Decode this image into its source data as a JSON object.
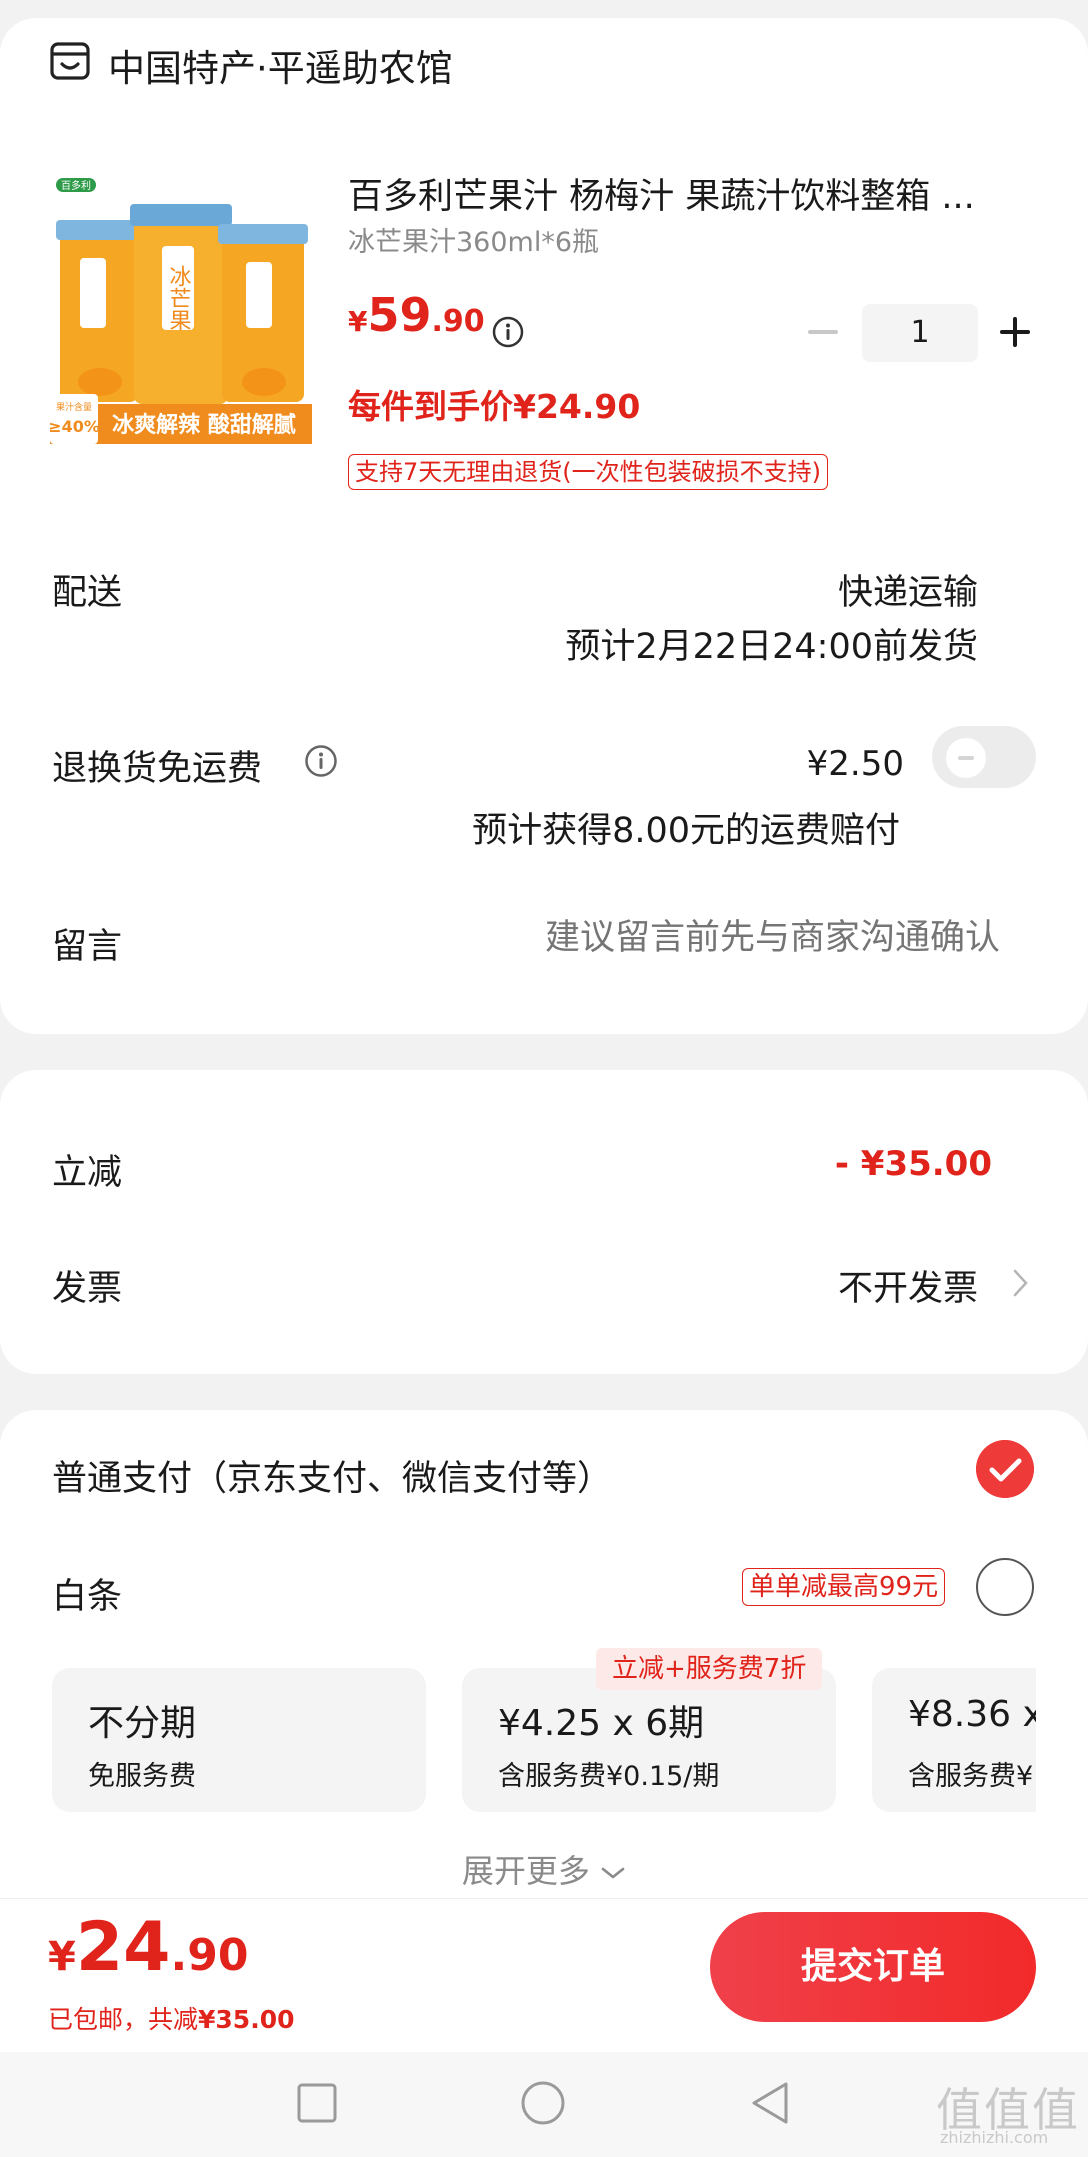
{
  "shop": {
    "name": "中国特产·平遥助农馆",
    "icon": "store-icon"
  },
  "product": {
    "title": "百多利芒果汁 杨梅汁 果蔬汁饮料整箱 ...",
    "spec": "冰芒果汁360ml*6瓶",
    "price_yen": "¥",
    "price_int": "59",
    "price_dec": ".90",
    "final_price": "每件到手价¥24.90",
    "return_policy": "支持7天无理由退货(一次性包装破损不支持)",
    "quantity": "1",
    "image_brand": "百多利",
    "image_text": "冰芒果",
    "image_juice": "果汁含量",
    "image_juice_pct": "≥40%",
    "image_slogan": "冰爽解辣 酸甜解腻"
  },
  "shipping": {
    "label": "配送",
    "method": "快递运输",
    "date": "预计2月22日24:00前发货"
  },
  "return_shipping": {
    "label": "退换货免运费",
    "price": "¥2.50",
    "compensation": "预计获得8.00元的运费赔付",
    "enabled": false
  },
  "message": {
    "label": "留言",
    "placeholder": "建议留言前先与商家沟通确认"
  },
  "discount": {
    "label": "立减",
    "value": "- ¥35.00"
  },
  "invoice": {
    "label": "发票",
    "value": "不开发票"
  },
  "payment": {
    "normal_label": "普通支付（京东支付、微信支付等）",
    "normal_selected": true,
    "baitiao_label": "白条",
    "baitiao_tag": "单单减最高99元",
    "baitiao_selected": false,
    "installments": [
      {
        "title": "不分期",
        "sub": "免服务费"
      },
      {
        "title": "¥4.25 x 6期",
        "sub": "含服务费¥0.15/期",
        "badge": "立减+服务费7折"
      },
      {
        "title": "¥8.36 x",
        "sub": "含服务费¥"
      }
    ],
    "expand_label": "展开更多"
  },
  "footer": {
    "total_yen": "¥",
    "total_int": "24",
    "total_dec": ".90",
    "ship_note": "已包邮，共减",
    "ship_note_amount": "¥35.00",
    "submit_label": "提交订单"
  },
  "watermark": {
    "text": "值值值",
    "sub": "zhizhizhi.com"
  },
  "colors": {
    "accent": "#e0231b",
    "button": "#f22a2a"
  }
}
